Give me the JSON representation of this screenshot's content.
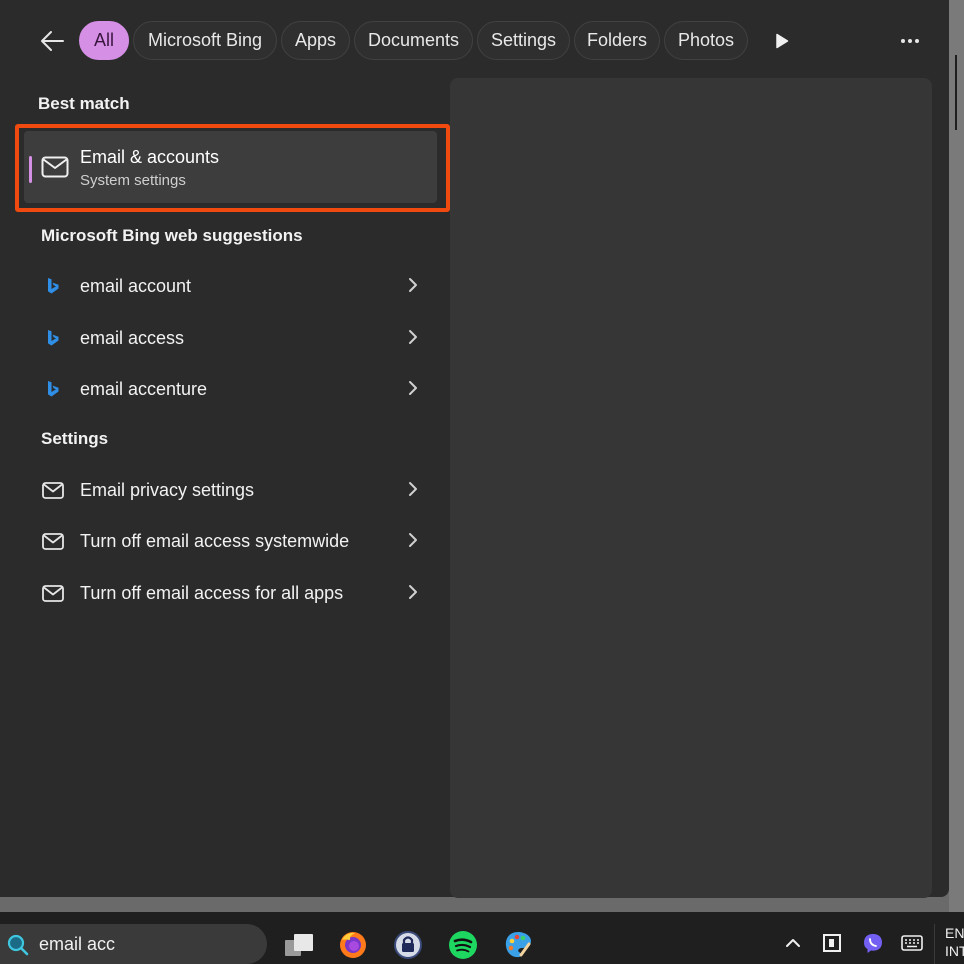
{
  "header": {
    "filters": [
      {
        "label": "All",
        "active": true
      },
      {
        "label": "Microsoft Bing"
      },
      {
        "label": "Apps"
      },
      {
        "label": "Documents"
      },
      {
        "label": "Settings"
      },
      {
        "label": "Folders"
      },
      {
        "label": "Photos"
      }
    ],
    "back_icon": "arrow-left-icon",
    "play_icon": "play-icon",
    "more_icon": "more-horizontal-icon"
  },
  "best_match": {
    "heading": "Best match",
    "title": "Email & accounts",
    "subtitle": "System settings",
    "icon": "mail-icon"
  },
  "bing": {
    "heading": "Microsoft Bing web suggestions",
    "items": [
      {
        "label": "email account"
      },
      {
        "label": "email access"
      },
      {
        "label": "email accenture"
      }
    ]
  },
  "settings": {
    "heading": "Settings",
    "items": [
      {
        "label": "Email privacy settings"
      },
      {
        "label": "Turn off email access systemwide"
      },
      {
        "label": "Turn off email access for all apps"
      }
    ]
  },
  "taskbar": {
    "search_value": "email acc",
    "apps": [
      "task-view-icon",
      "firefox-icon",
      "keepass-icon",
      "spotify-icon",
      "paint-icon"
    ],
    "tray": [
      "chevron-up-icon",
      "parsec-icon",
      "viber-icon",
      "keyboard-icon"
    ],
    "lang_line1": "EN",
    "lang_line2": "INT"
  },
  "colors": {
    "accent": "#d590e6",
    "highlight": "#f04a10",
    "panel": "#2b2b2b"
  }
}
